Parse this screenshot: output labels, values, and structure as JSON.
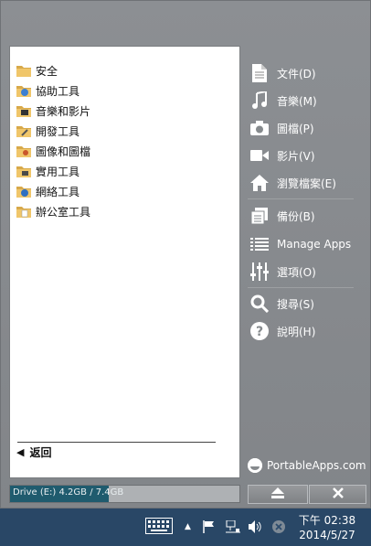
{
  "categories": [
    {
      "label": "安全",
      "icon": "folder-icon"
    },
    {
      "label": "協助工具",
      "icon": "folder-icon"
    },
    {
      "label": "音樂和影片",
      "icon": "folder-icon"
    },
    {
      "label": "開發工具",
      "icon": "folder-icon"
    },
    {
      "label": "圖像和圖檔",
      "icon": "folder-icon"
    },
    {
      "label": "實用工具",
      "icon": "folder-icon"
    },
    {
      "label": "網絡工具",
      "icon": "folder-icon"
    },
    {
      "label": "辦公室工具",
      "icon": "folder-icon"
    }
  ],
  "back_label": "返回",
  "drive": {
    "text": "Drive (E:) 4.2GB / 7.4GB",
    "used_fraction": 0.43
  },
  "right_menu": {
    "documents": "文件(D)",
    "music": "音樂(M)",
    "pictures": "圖檔(P)",
    "videos": "影片(V)",
    "explore": "瀏覽檔案(E)",
    "backup": "備份(B)",
    "manage_apps": "Manage Apps",
    "options": "選項(O)",
    "search": "搜尋(S)",
    "help": "說明(H)"
  },
  "brand": "PortableApps.com",
  "taskbar": {
    "time": "下午 02:38",
    "date": "2014/5/27"
  }
}
